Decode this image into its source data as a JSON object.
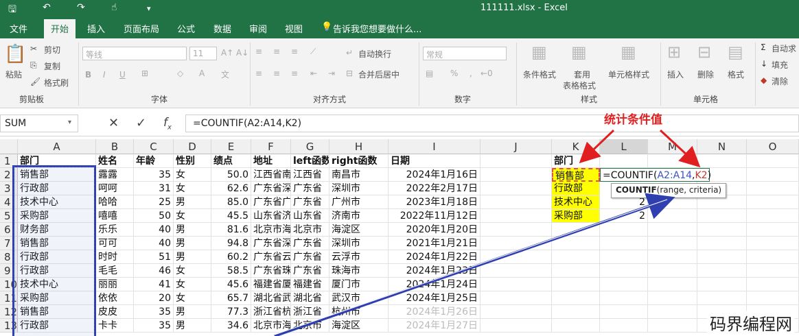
{
  "window": {
    "title": "111111.xlsx - Excel"
  },
  "tabs": [
    "文件",
    "开始",
    "插入",
    "页面布局",
    "公式",
    "数据",
    "审阅",
    "视图"
  ],
  "tell_me": "告诉我您想要做什么...",
  "ribbon": {
    "clipboard": {
      "paste": "粘贴",
      "cut": "剪切",
      "copy": "复制",
      "format_painter": "格式刷",
      "group": "剪贴板"
    },
    "font": {
      "name": "等线",
      "size": "11",
      "group": "字体"
    },
    "alignment": {
      "wrap": "自动换行",
      "merge": "合并后居中",
      "group": "对齐方式"
    },
    "number": {
      "format": "常规",
      "group": "数字"
    },
    "styles": {
      "cond": "条件格式",
      "table1": "套用",
      "table2": "表格格式",
      "cell": "单元格样式",
      "group": "样式"
    },
    "cells": {
      "insert": "插入",
      "delete": "删除",
      "format": "格式",
      "group": "单元格"
    },
    "editing": {
      "autosum": "自动求",
      "fill": "填充",
      "clear": "清除"
    }
  },
  "formula_bar": {
    "name_box": "SUM",
    "formula": "=COUNTIF(A2:A14,K2)"
  },
  "columns": [
    "A",
    "B",
    "C",
    "D",
    "E",
    "F",
    "G",
    "H",
    "I",
    "J",
    "K",
    "L",
    "M",
    "N",
    "O"
  ],
  "rows": [
    "1",
    "2",
    "3",
    "4",
    "5",
    "6",
    "7",
    "8",
    "9",
    "10",
    "11",
    "12",
    "13"
  ],
  "headers": [
    "部门",
    "姓名",
    "年龄",
    "性别",
    "绩点",
    "地址",
    "left函数",
    "right函数",
    "日期"
  ],
  "data": [
    [
      "销售部",
      "露露",
      "35",
      "女",
      "50.0",
      "江西省南",
      "江西省",
      "南昌市",
      "2024年1月16日"
    ],
    [
      "行政部",
      "呵呵",
      "31",
      "女",
      "62.6",
      "广东省深",
      "广东省",
      "深圳市",
      "2022年2月17日"
    ],
    [
      "技术中心",
      "哈哈",
      "25",
      "男",
      "85.0",
      "广东省广",
      "广东省",
      "广州市",
      "2023年1月18日"
    ],
    [
      "采购部",
      "嘻嘻",
      "50",
      "女",
      "45.5",
      "山东省济",
      "山东省",
      "济南市",
      "2022年11月12日"
    ],
    [
      "财务部",
      "乐乐",
      "40",
      "男",
      "81.6",
      "北京市海",
      "北京市",
      "海淀区",
      "2020年1月20日"
    ],
    [
      "销售部",
      "可可",
      "40",
      "男",
      "94.8",
      "广东省深",
      "广东省",
      "深圳市",
      "2021年1月21日"
    ],
    [
      "行政部",
      "时时",
      "51",
      "男",
      "60.2",
      "广东省云",
      "广东省",
      "云浮市",
      "2024年1月22日"
    ],
    [
      "行政部",
      "毛毛",
      "46",
      "女",
      "58.5",
      "广东省珠",
      "广东省",
      "珠海市",
      "2024年1月23日"
    ],
    [
      "技术中心",
      "丽丽",
      "41",
      "女",
      "45.6",
      "福建省厦",
      "福建省",
      "厦门市",
      "2024年1月24日"
    ],
    [
      "采购部",
      "依依",
      "20",
      "女",
      "65.7",
      "湖北省武",
      "湖北省",
      "武汉市",
      "2024年1月25日"
    ],
    [
      "销售部",
      "皮皮",
      "35",
      "男",
      "77.3",
      "浙江省杭",
      "浙江省",
      "杭州市",
      "2024年1月26日"
    ],
    [
      "行政部",
      "卡卡",
      "35",
      "男",
      "34.6",
      "北京市海",
      "北京市",
      "海淀区",
      "2024年1月27日"
    ]
  ],
  "k_col": {
    "header": "部门",
    "values": [
      "销售部",
      "行政部",
      "技术中心",
      "采购部"
    ]
  },
  "l_col": {
    "edit_prefix": "=COUNTIF(",
    "edit_range": "A2:A14",
    "edit_sep": ",",
    "edit_ref": "K2",
    "edit_close": ")",
    "values": [
      "2",
      "2"
    ]
  },
  "tooltip": {
    "func": "COUNTIF",
    "args": "(range, criteria)"
  },
  "annotation": "统计条件值",
  "watermark": "码界编程网",
  "colors": {
    "accent": "#217346",
    "highlight": "#ffff00",
    "annotation": "#e02020",
    "selection": "#2f3fb0"
  }
}
